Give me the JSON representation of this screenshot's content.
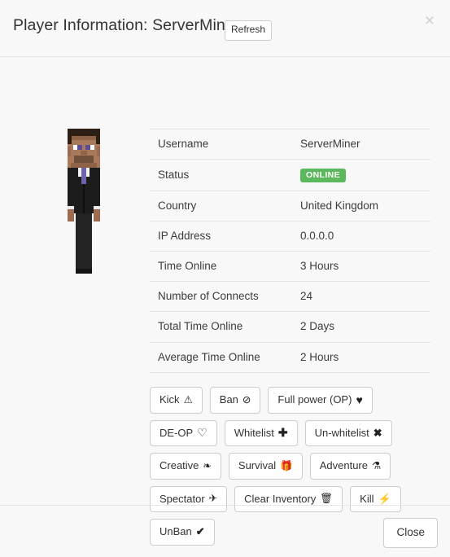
{
  "header": {
    "title": "Player Information: ServerMiner",
    "refresh_label": "Refresh",
    "close_icon": "×"
  },
  "avatar": {
    "icon_name": "minecraft-player-skin",
    "description": "Minecraft player skin wearing black suit with purple tie"
  },
  "info": {
    "rows": [
      {
        "label": "Username",
        "value": "ServerMiner",
        "type": "text"
      },
      {
        "label": "Status",
        "value": "ONLINE",
        "type": "badge"
      },
      {
        "label": "Country",
        "value": "United Kingdom",
        "type": "text"
      },
      {
        "label": "IP Address",
        "value": "0.0.0.0",
        "type": "text"
      },
      {
        "label": "Time Online",
        "value": "3 Hours",
        "type": "text"
      },
      {
        "label": "Number of Connects",
        "value": "24",
        "type": "text"
      },
      {
        "label": "Total Time Online",
        "value": "2 Days",
        "type": "text"
      },
      {
        "label": "Average Time Online",
        "value": "2 Hours",
        "type": "text"
      }
    ]
  },
  "actions": {
    "rows": [
      [
        {
          "label": "Kick",
          "glyph": "⚠",
          "icon": "warning-triangle-icon"
        },
        {
          "label": "Ban",
          "glyph": "⊘",
          "icon": "ban-circle-icon"
        },
        {
          "label": "Full power (OP)",
          "glyph": "♥",
          "icon": "heart-filled-icon"
        }
      ],
      [
        {
          "label": "DE-OP",
          "glyph": "♡",
          "icon": "heart-open-icon"
        },
        {
          "label": "Whitelist",
          "glyph": "✚",
          "icon": "plus-icon"
        },
        {
          "label": "Un-whitelist",
          "glyph": "✖",
          "icon": "x-mark-icon"
        }
      ],
      [
        {
          "label": "Creative",
          "glyph": "❧",
          "icon": "cubes-icon"
        },
        {
          "label": "Survival",
          "glyph": "🎁",
          "icon": "box-icon"
        },
        {
          "label": "Adventure",
          "glyph": "⚗",
          "icon": "flask-icon"
        }
      ],
      [
        {
          "label": "Spectator",
          "glyph": "✈",
          "icon": "airplane-icon"
        },
        {
          "label": "Clear Inventory",
          "glyph": "🗑",
          "icon": "trash-icon"
        },
        {
          "label": "Kill",
          "glyph": "⚡",
          "icon": "lightning-bolt-icon"
        }
      ],
      [
        {
          "label": "UnBan",
          "glyph": "✔",
          "icon": "check-mark-icon"
        }
      ]
    ]
  },
  "footer": {
    "close_label": "Close"
  },
  "colors": {
    "status_online": "#5cb85c",
    "page_background": "#f8f8f8",
    "border": "#e5e5e5",
    "text": "#333333"
  }
}
